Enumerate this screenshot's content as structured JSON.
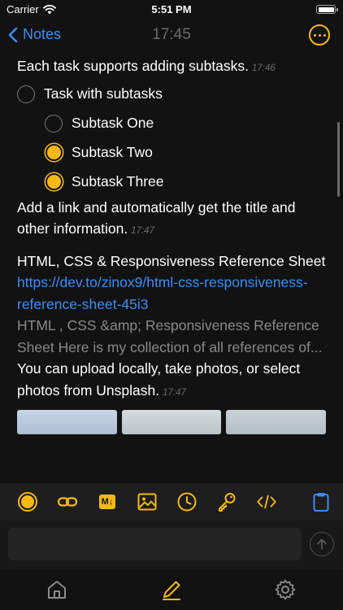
{
  "status_bar": {
    "carrier": "Carrier",
    "time": "5:51 PM"
  },
  "nav": {
    "back_label": "Notes",
    "title": "17:45"
  },
  "note": {
    "intro_text": "Each task supports adding subtasks.",
    "intro_time": "17:46",
    "task": "Task with subtasks",
    "subtasks": [
      {
        "label": "Subtask One",
        "checked": false
      },
      {
        "label": "Subtask Two",
        "checked": true
      },
      {
        "label": "Subtask Three",
        "checked": true
      }
    ],
    "link_intro_text": "Add a link and automatically get the title and other information.",
    "link_intro_time": "17:47",
    "link_title": "HTML, CSS & Responsiveness Reference Sheet",
    "link_url": "https://dev.to/zinox9/html-css-responsiveness-reference-sheet-45i3",
    "link_description": "HTML , CSS &amp; Responsiveness Reference Sheet   Here is my collection of all references of...",
    "upload_text": "You can upload locally, take photos, or select photos from Unsplash.",
    "upload_time": "17:47"
  },
  "toolbar": {
    "icons": [
      "checkbox-icon",
      "link-icon",
      "markdown-icon",
      "image-icon",
      "clock-icon",
      "key-icon",
      "code-icon",
      "clipboard-icon"
    ],
    "markdown_label": "M↓"
  },
  "input": {
    "placeholder": ""
  },
  "tab_bar": {
    "icons": [
      "home-icon",
      "pencil-icon",
      "gear-icon"
    ]
  },
  "colors": {
    "background": "#121212",
    "accent": "#f5b915",
    "link": "#3a8ef6",
    "muted": "#6b6b6b"
  }
}
